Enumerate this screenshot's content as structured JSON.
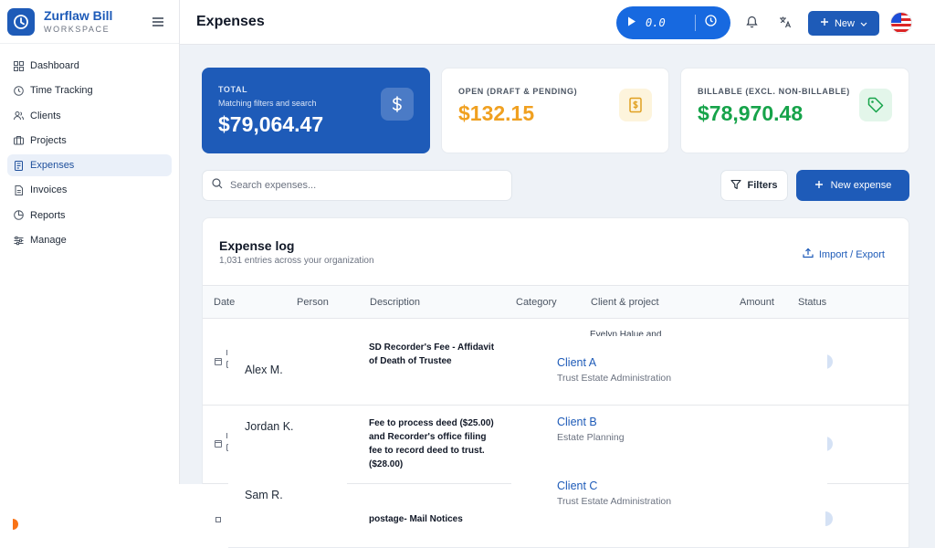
{
  "brand": {
    "name": "Zurflaw Bill",
    "subtitle": "WORKSPACE"
  },
  "sidebar": {
    "items": [
      {
        "label": "Dashboard",
        "icon": "grid-icon",
        "active": false
      },
      {
        "label": "Time Tracking",
        "icon": "clock-icon",
        "active": false
      },
      {
        "label": "Clients",
        "icon": "users-icon",
        "active": false
      },
      {
        "label": "Projects",
        "icon": "briefcase-icon",
        "active": false
      },
      {
        "label": "Expenses",
        "icon": "receipt-icon",
        "active": true
      },
      {
        "label": "Invoices",
        "icon": "document-icon",
        "active": false
      },
      {
        "label": "Reports",
        "icon": "pie-chart-icon",
        "active": false
      },
      {
        "label": "Manage",
        "icon": "sliders-icon",
        "active": false
      }
    ]
  },
  "header": {
    "title": "Expenses",
    "timer_value": "0.0",
    "new_label": "New"
  },
  "stats": {
    "total": {
      "label": "TOTAL",
      "sub": "Matching filters and search",
      "value": "$79,064.47"
    },
    "open": {
      "label": "OPEN (DRAFT & PENDING)",
      "value": "$132.15"
    },
    "billable": {
      "label": "BILLABLE (EXCL. NON-BILLABLE)",
      "value": "$78,970.48"
    }
  },
  "toolbar": {
    "search_placeholder": "Search expenses...",
    "filters_label": "Filters",
    "new_expense_label": "New expense"
  },
  "log": {
    "title": "Expense log",
    "subtitle": "1,031 entries across your organization",
    "import_label": "Import / Export",
    "columns": [
      "Date",
      "Person",
      "Description",
      "Category",
      "Client & project",
      "Amount",
      "Status"
    ],
    "cut_text": "Evelyn Halue and",
    "rows": [
      {
        "person": "Alex M.",
        "description": "SD Recorder's Fee - Affidavit of Death of Trustee",
        "client": "Client A",
        "project": "Trust Estate Administration"
      },
      {
        "person": "Jordan K.",
        "description": "Fee to process deed ($25.00) and Recorder's office filing fee to record deed to trust.($28.00)",
        "client": "Client B",
        "project": "Estate Planning"
      },
      {
        "person": "Sam R.",
        "description": "postage- Mail Notices",
        "client": "Client C",
        "project": "Trust Estate Administration"
      }
    ]
  },
  "colors": {
    "primary": "#1e5bb8",
    "open_value": "#f0a020",
    "billable_value": "#16a34a"
  }
}
